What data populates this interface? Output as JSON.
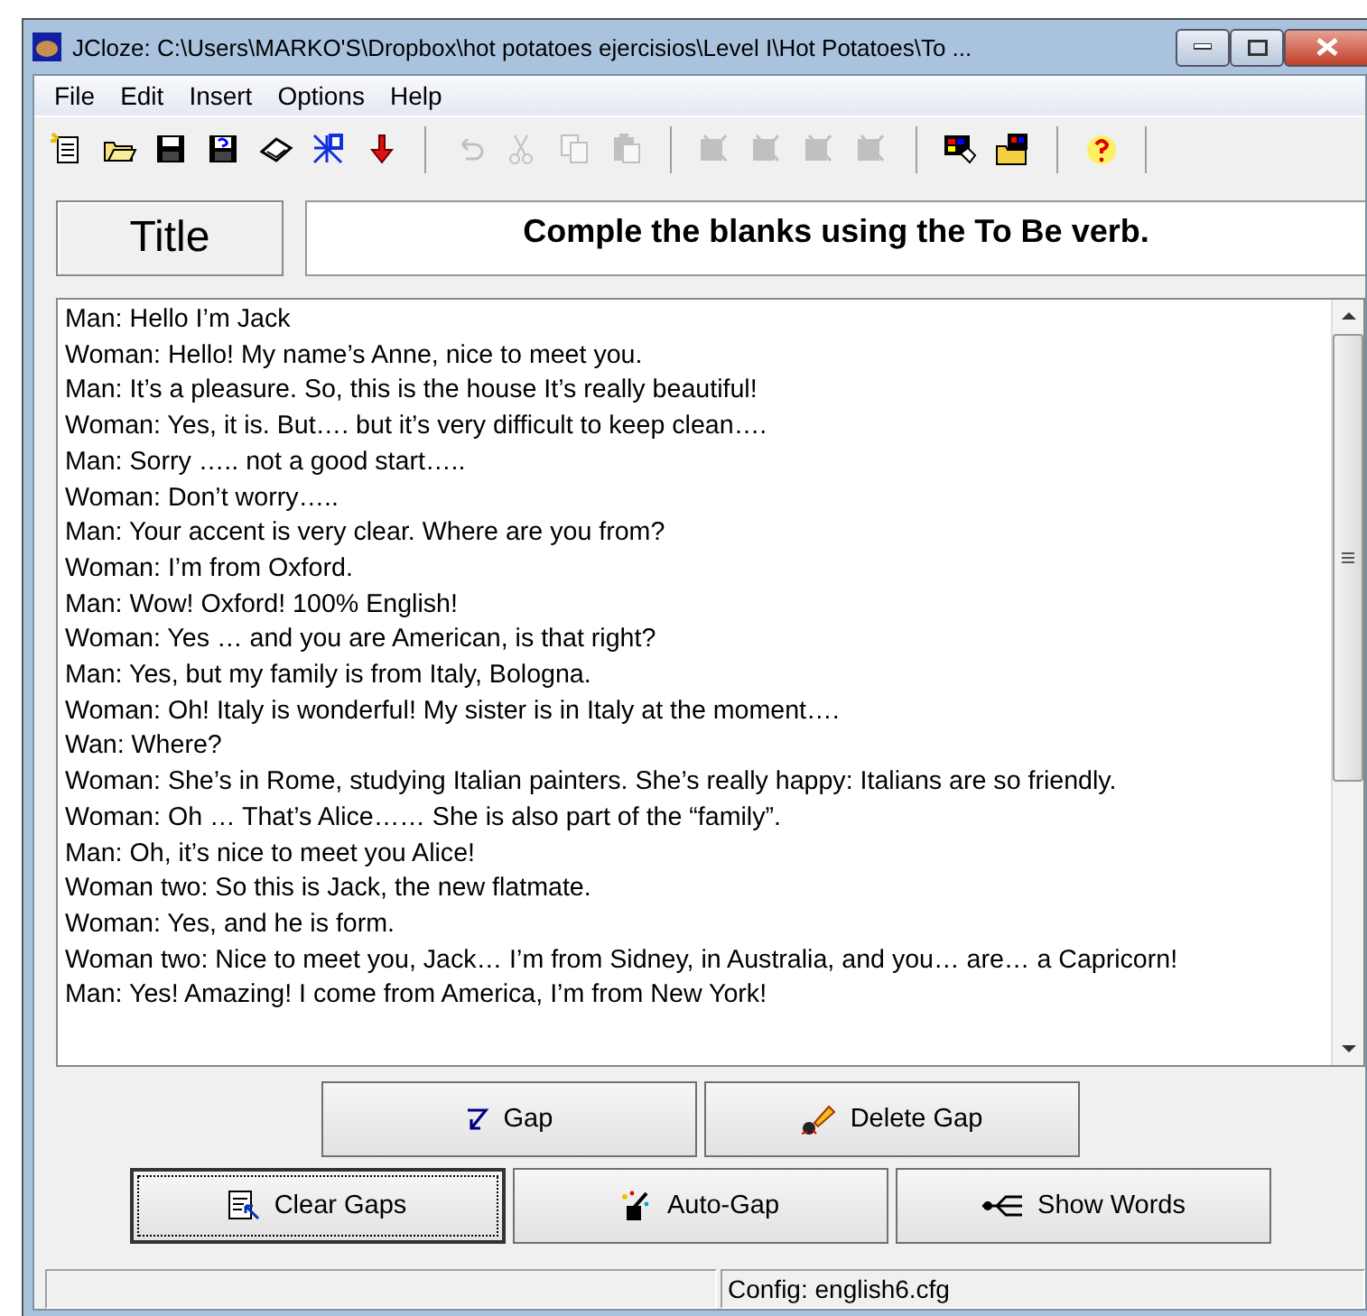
{
  "window": {
    "title": "JCloze: C:\\Users\\MARKO'S\\Dropbox\\hot potatoes ejercisios\\Level I\\Hot Potatoes\\To ..."
  },
  "menu": [
    "File",
    "Edit",
    "Insert",
    "Options",
    "Help"
  ],
  "toolbar": [
    [
      {
        "kind": "new",
        "disabled": false
      },
      {
        "kind": "open",
        "disabled": false
      },
      {
        "kind": "save",
        "disabled": false
      },
      {
        "kind": "save-as",
        "disabled": false
      },
      {
        "kind": "book",
        "disabled": false
      },
      {
        "kind": "web",
        "disabled": false
      },
      {
        "kind": "export",
        "disabled": false
      }
    ],
    [
      {
        "kind": "undo",
        "disabled": true
      },
      {
        "kind": "cut",
        "disabled": true
      },
      {
        "kind": "copy",
        "disabled": true
      },
      {
        "kind": "paste",
        "disabled": true
      }
    ],
    [
      {
        "kind": "gap",
        "disabled": true
      },
      {
        "kind": "gap",
        "disabled": true
      },
      {
        "kind": "gap",
        "disabled": true
      },
      {
        "kind": "gap",
        "disabled": true
      }
    ],
    [
      {
        "kind": "palette",
        "disabled": false
      },
      {
        "kind": "folder-palette",
        "disabled": false
      }
    ],
    [
      {
        "kind": "help",
        "disabled": false
      }
    ]
  ],
  "title_label": "Title",
  "title_value": "Comple the blanks using the To Be verb.",
  "text_lines": [
    "Man: Hello I’m Jack",
    "Woman: Hello! My name’s Anne, nice to meet you.",
    "Man: It’s a pleasure. So, this is the house It’s really beautiful!",
    "Woman: Yes, it is. But…. but it’s very difficult to keep clean….",
    "Man: Sorry ….. not a good start…..",
    "Woman: Don’t worry…..",
    "Man: Your accent is very clear. Where are you from?",
    "Woman: I’m from Oxford.",
    "Man: Wow! Oxford! 100% English!",
    "Woman: Yes … and you are American, is that right?",
    "Man: Yes, but my family is from Italy, Bologna.",
    "Woman: Oh! Italy is wonderful! My sister is in Italy at the moment….",
    "Wan: Where?",
    "Woman: She’s in Rome, studying Italian painters. She’s really happy: Italians are so friendly.",
    "Woman: Oh … That’s Alice…… She is also part of the “family”.",
    "Man: Oh, it’s nice to meet you Alice!",
    "Woman two: So this is Jack, the new flatmate.",
    "Woman: Yes, and he is form.",
    "Woman two: Nice to meet you, Jack… I’m from Sidney, in Australia, and you… are… a Capricorn!",
    "Man: Yes! Amazing! I come from America, I’m from New York!"
  ],
  "button_rows": [
    [
      {
        "kind": "gap",
        "label": "Gap",
        "focused": false
      },
      {
        "kind": "delete",
        "label": "Delete Gap",
        "focused": false
      }
    ],
    [
      {
        "kind": "clear",
        "label": "Clear Gaps",
        "focused": true
      },
      {
        "kind": "auto",
        "label": "Auto-Gap",
        "focused": false
      },
      {
        "kind": "words",
        "label": "Show Words",
        "focused": false
      }
    ]
  ],
  "status_bar": [
    "Config: english6.cfg"
  ]
}
